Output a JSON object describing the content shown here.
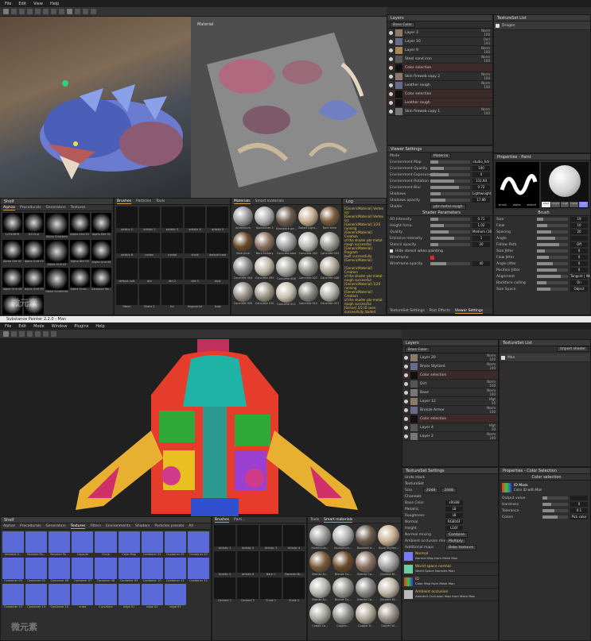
{
  "top": {
    "menu": [
      "File",
      "Edit",
      "View",
      "Help"
    ],
    "viewport_2d_title": "Material",
    "watermark": "微元素",
    "layers": {
      "title": "Layers",
      "channel": "Base Color",
      "rows": [
        {
          "name": "Layer 3",
          "mode": "Norm",
          "val": "100"
        },
        {
          "name": "Layer 10",
          "mode": "Ovrl",
          "val": "100"
        },
        {
          "name": "Layer 9",
          "mode": "Norm",
          "val": "100"
        },
        {
          "name": "Steel sand iron",
          "mode": "Norm",
          "val": "100"
        },
        {
          "name": "Color selection",
          "mode": "",
          "val": ""
        },
        {
          "name": "Skin fireweb copy 2",
          "mode": "Norm",
          "val": "100"
        },
        {
          "name": "Leather rough",
          "mode": "Norm",
          "val": "100"
        },
        {
          "name": "Color selection",
          "mode": "",
          "val": ""
        },
        {
          "name": "Leather rough",
          "mode": "",
          "val": ""
        },
        {
          "name": "Skin fireweb copy 1",
          "mode": "Norm",
          "val": "100"
        }
      ]
    },
    "texture_set_list": {
      "title": "TextureSet List",
      "item": "Dragon"
    },
    "viewer_settings": {
      "title": "Viewer Settings",
      "mode_label": "Mode",
      "mode_value": "Material",
      "rows": [
        {
          "k": "Environment Map",
          "v": "studio_hdr"
        },
        {
          "k": "Environment Opacity",
          "v": "100"
        },
        {
          "k": "Environment Exposure (EV)",
          "v": "0"
        },
        {
          "k": "Environment Rotation",
          "v": "131.94"
        },
        {
          "k": "Environment Blur",
          "v": "0.72"
        },
        {
          "k": "Shadows",
          "v": "Lightweight computation"
        },
        {
          "k": "Shadows opacity",
          "v": "17.86"
        }
      ],
      "shader_label": "Shader",
      "shader_value": "pbr-metal-rough",
      "shader_params_title": "Shader Parameters",
      "shader_rows": [
        {
          "k": "AO Intensity",
          "v": "0.71"
        },
        {
          "k": "Height force",
          "v": "1.02"
        },
        {
          "k": "Quality",
          "v": "Medium (16 spp)"
        },
        {
          "k": "Emissive Intensity",
          "v": "1"
        }
      ],
      "stencil_label": "Stencil opacity",
      "stencil_value": "20",
      "hide_stencil": "Hide stencil when painting",
      "wireframe": "Wireframe",
      "wireframe_opacity_label": "Wireframe opacity",
      "wireframe_opacity": "40",
      "footer_tabs": [
        "TextureSet Settings",
        "Post Effects",
        "Viewer Settings"
      ]
    },
    "properties": {
      "title": "Properties - Paint",
      "thumb_labels": [
        "brush",
        "alpha",
        "stencil"
      ],
      "mat_labels": [
        "color",
        "height",
        "rough",
        "metal",
        "nrm"
      ],
      "brush_title": "Brush",
      "rows": [
        {
          "k": "Size",
          "v": "19"
        },
        {
          "k": "Flow",
          "v": "10"
        },
        {
          "k": "Spacing",
          "v": "20"
        },
        {
          "k": "Angle",
          "v": ""
        },
        {
          "k": "Follow Path",
          "v": "Off"
        },
        {
          "k": "Size Jitter",
          "v": "0"
        },
        {
          "k": "Flow Jitter",
          "v": "0"
        },
        {
          "k": "Angle Jitter",
          "v": "0"
        },
        {
          "k": "Position Jitter",
          "v": "0"
        },
        {
          "k": "Alignment",
          "v": "Tangent | Wrap"
        },
        {
          "k": "Backface culling",
          "v": "On"
        },
        {
          "k": "Size Space",
          "v": "Object"
        }
      ]
    },
    "shelf": {
      "title": "Shelf",
      "tabs": [
        "Alphas",
        "Procedurals",
        "Generators",
        "Textures"
      ],
      "items": [
        "12345678",
        "8119-xl",
        "Alpha Checkers",
        "Alpha Grid 01",
        "Alpha Dirt 01",
        "Alpha Dirt 02",
        "Alpha Grid 03",
        "Alpha Grid 04",
        "Alpha Dirt 05",
        "Alpha Grid 06",
        "Alpha Grid 08",
        "Alpha Grid 09",
        "Alpha Scratches",
        "Alpha Scrat...",
        "Gaussian No...",
        "Sharp line",
        "Mottled"
      ]
    },
    "brushes": {
      "tabs": [
        "Brushes",
        "Particles",
        "Tools"
      ],
      "items": [
        "artistic 1",
        "artistic 2",
        "artistic 3",
        "artistic 4",
        "artistic 5",
        "artistic 6",
        "cotton",
        "crystal",
        "chalk",
        "default hard",
        "default soft",
        "dirt",
        "dirt 2",
        "dirt 3",
        "dust",
        "fibers",
        "fibers 2",
        "fur",
        "fingerprint",
        "frost"
      ]
    },
    "materials": {
      "tabs": [
        "Materials",
        "Smart materials"
      ],
      "items": [
        "Aluminium",
        "Aluminium 2",
        "Backpack pa...",
        "Baked Light...",
        "Bark birch",
        "Bark pine",
        "Bark hickory",
        "Concrete bare",
        "Concrete 002",
        "Concrete 003",
        "Concrete 004",
        "Concrete 005",
        "Concrete 006",
        "Concrete 007",
        "Concrete 008",
        "Concrete 009",
        "Concrete 010",
        "Concrete 011",
        "Concrete 012",
        "Concrete 013"
      ]
    },
    "log": {
      "title": "Log",
      "text": "[GenericMaterial] Vertex\nsrc\n[GenericMaterial] Vertex\nsrc\n[GenericMaterial] 1/20\nrunning\n[GenericMaterial] Creation\nof the shader pbr-metal-\nrough successful\n[GenericMaterial] Program\nbuilt successfully\n[GenericMaterial]\n\n[GenericMaterial] Creation\nof the shader pbr-metal-\nrough successful\n[GenericMaterial] 1/20\nrunning\n[GenericMaterial] Creation\nof the shader pbr-metal-\nrough successful\n[Scene] 1/2 ID seen\nsuccessfully loaded"
    }
  },
  "bottom": {
    "window_title": "Substance Painter 2.2.0 - Man",
    "menu": [
      "File",
      "Edit",
      "Mode",
      "Window",
      "Plugins",
      "Help"
    ],
    "watermark": "微元素",
    "layers": {
      "title": "Layers",
      "channel": "Base Color",
      "rows": [
        {
          "name": "Layer 20",
          "mode": "Norm",
          "val": "100"
        },
        {
          "name": "Brass Stylized",
          "mode": "Norm",
          "val": "100"
        },
        {
          "name": "Color selection",
          "mode": "",
          "val": ""
        },
        {
          "name": "Dirt",
          "mode": "Norm",
          "val": "100"
        },
        {
          "name": "Base",
          "mode": "Norm",
          "val": "100"
        },
        {
          "name": "Layer 12",
          "mode": "Hlgt",
          "val": "15"
        },
        {
          "name": "Bronze Armor",
          "mode": "Norm",
          "val": "100"
        },
        {
          "name": "Color selection",
          "mode": "",
          "val": ""
        },
        {
          "name": "Layer 4",
          "mode": "Hlgt",
          "val": "30"
        },
        {
          "name": "Layer 2",
          "mode": "Norm",
          "val": "100"
        }
      ]
    },
    "texture_set_list": {
      "title": "TextureSet List",
      "item": "Man",
      "btn": "Import shader"
    },
    "texture_set_settings": {
      "title": "TextureSet Settings",
      "undo": "Undo stack",
      "ts_label": "TextureSet",
      "size_label": "Size",
      "size_value": "2048",
      "size_value2": "2048",
      "channels_title": "Channels",
      "channels": [
        {
          "k": "Base Color",
          "v": "sRGB8"
        },
        {
          "k": "Metallic",
          "v": "L8"
        },
        {
          "k": "Roughness",
          "v": "L8"
        },
        {
          "k": "Normal",
          "v": "RGB16F"
        },
        {
          "k": "Height",
          "v": "L16F"
        }
      ],
      "normal_mix_label": "Normal mixing",
      "normal_mix_value": "Combine",
      "ao_mix_label": "Ambient occlusion mixing",
      "ao_mix_value": "Multiply",
      "maps_label": "Additional maps",
      "bake_btn": "Bake textures",
      "maps": [
        {
          "title": "Normal",
          "sub": "Normal Map from Mesh Man"
        },
        {
          "title": "World space normal",
          "sub": "World Space Normals Man"
        },
        {
          "title": "ID",
          "sub": "Color Map from Mesh Man"
        },
        {
          "title": "Ambient occlusion",
          "sub": "Ambient Occlusion Map from Mesh Man"
        }
      ]
    },
    "properties": {
      "title": "Properties - Color Selection",
      "section": "Color selection",
      "idmask_title": "ID Mask",
      "idmask_sub": "Color ID with Man",
      "rows": [
        {
          "k": "Output value",
          "v": ""
        },
        {
          "k": "Hardness",
          "v": "0"
        },
        {
          "k": "Tolerance",
          "v": "0.1"
        },
        {
          "k": "Colors",
          "v": "Pick color"
        }
      ]
    },
    "shelf": {
      "title": "Shelf",
      "tabs": [
        "Alphas",
        "Procedurals",
        "Generators",
        "Textures",
        "Filters",
        "Environments",
        "Shaders",
        "Particles presets",
        "All"
      ],
      "items": [
        "Ambient O...",
        "Beveled Pa...",
        "Beveled Pa...",
        "Capsule",
        "Circle",
        "Color Map",
        "Container 01",
        "Container 02",
        "Container 03",
        "Container 04",
        "Container 05",
        "Container 06",
        "Container 07",
        "Container 08",
        "Container 09",
        "Container 10",
        "Container 11",
        "Container 12",
        "Container 13",
        "Container 14",
        "Container 15",
        "cross",
        "Curvature",
        "edge 01",
        "edge 02",
        "edge 03"
      ]
    },
    "brushes": {
      "tabs": [
        "Brushes",
        "Parti..."
      ],
      "items": [
        "Artistic 1",
        "Artistic 2",
        "Artistic 3",
        "Artistic 4",
        "Artistic 5",
        "Artistic 6",
        "Bark 1",
        "Basmati Br...",
        "Cement 1",
        "Cement 2",
        "Chalk 1",
        "Chalk 2"
      ]
    },
    "materials": {
      "tabs": [
        "Tools",
        "Smart materials"
      ],
      "items": [
        "Aluminium...",
        "Aluminium...",
        "Baseball H...",
        "Bone Stylize...",
        "Bronze Ar...",
        "Bronze Co...",
        "Bronze Ca...",
        "Chrome Bl...",
        "Bronze Ar...",
        "Bronze Co...",
        "Bronze Ca...",
        "Chrome St...",
        "Cobalt Ca...",
        "Copper...",
        "Copper R...",
        "Copper W..."
      ]
    }
  }
}
